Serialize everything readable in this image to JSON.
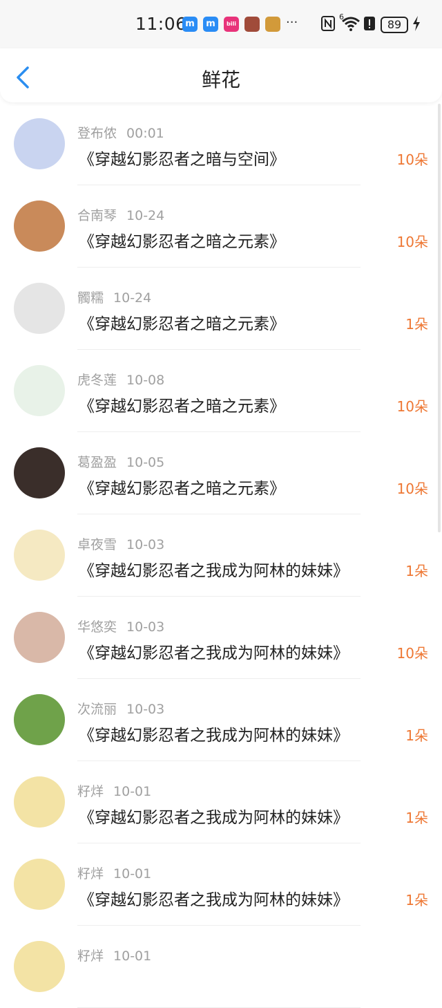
{
  "status_bar": {
    "time": "11:06",
    "battery": "89",
    "signal_label": "6"
  },
  "header": {
    "title": "鲜花"
  },
  "items": [
    {
      "name": "登布侬",
      "date": "00:01",
      "book": "《穿越幻影忍者之暗与空间》",
      "count": "10朵",
      "avatar_color": "#c9d4f0"
    },
    {
      "name": "合南琴",
      "date": "10-24",
      "book": "《穿越幻影忍者之暗之元素》",
      "count": "10朵",
      "avatar_color": "#c98a5a"
    },
    {
      "name": "髑糯",
      "date": "10-24",
      "book": "《穿越幻影忍者之暗之元素》",
      "count": "1朵",
      "avatar_color": "#e5e5e5"
    },
    {
      "name": "虎冬莲",
      "date": "10-08",
      "book": "《穿越幻影忍者之暗之元素》",
      "count": "10朵",
      "avatar_color": "#e8f2e8"
    },
    {
      "name": "葛盈盈",
      "date": "10-05",
      "book": "《穿越幻影忍者之暗之元素》",
      "count": "10朵",
      "avatar_color": "#3a2e2a"
    },
    {
      "name": "卓夜雪",
      "date": "10-03",
      "book": "《穿越幻影忍者之我成为阿林的妹妹》",
      "count": "1朵",
      "avatar_color": "#f5e9c2"
    },
    {
      "name": "华悠奕",
      "date": "10-03",
      "book": "《穿越幻影忍者之我成为阿林的妹妹》",
      "count": "10朵",
      "avatar_color": "#d9b8a8"
    },
    {
      "name": "次流丽",
      "date": "10-03",
      "book": "《穿越幻影忍者之我成为阿林的妹妹》",
      "count": "1朵",
      "avatar_color": "#6fa24a"
    },
    {
      "name": "籽烊",
      "date": "10-01",
      "book": "《穿越幻影忍者之我成为阿林的妹妹》",
      "count": "1朵",
      "avatar_color": "#f3e3a5"
    },
    {
      "name": "籽烊",
      "date": "10-01",
      "book": "《穿越幻影忍者之我成为阿林的妹妹》",
      "count": "1朵",
      "avatar_color": "#f3e3a5"
    },
    {
      "name": "籽烊",
      "date": "10-01",
      "book": "",
      "count": "",
      "avatar_color": "#f3e3a5"
    }
  ],
  "colors": {
    "accent": "#2b8ef0",
    "count": "#ee7733"
  }
}
